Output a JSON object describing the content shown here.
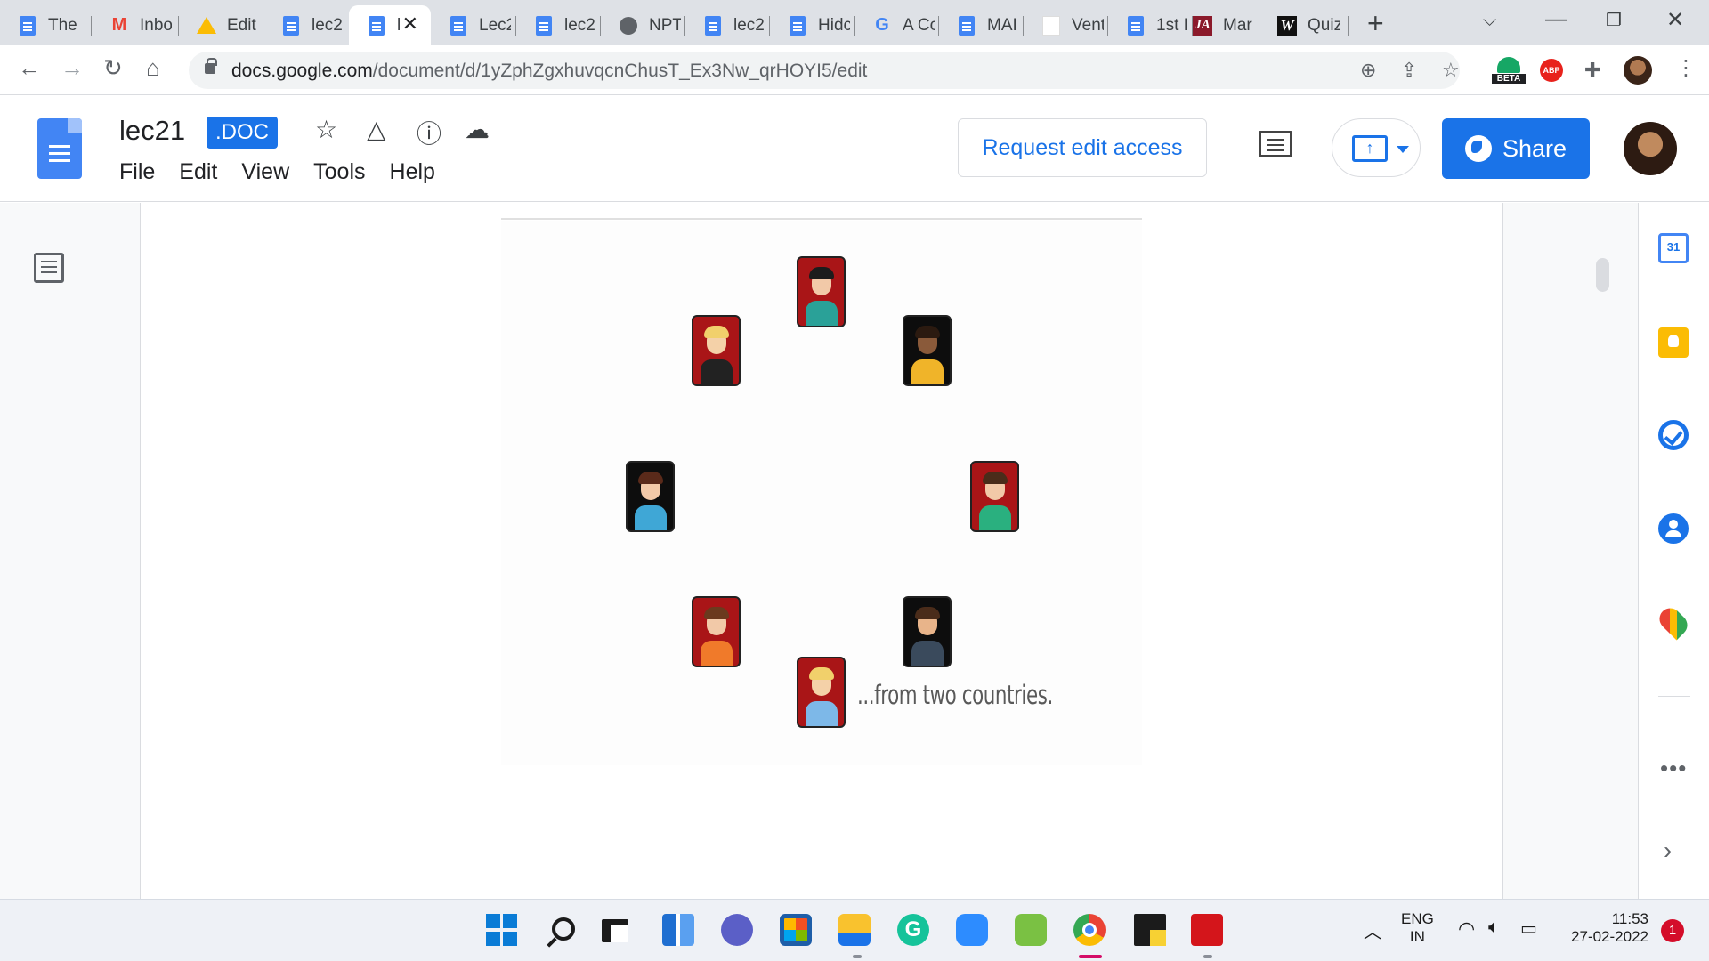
{
  "browser": {
    "tabs": [
      {
        "label": "The",
        "icon": "docs-icon"
      },
      {
        "label": "Inbo",
        "icon": "gmail-icon"
      },
      {
        "label": "Edit",
        "icon": "drive-icon"
      },
      {
        "label": "lec2",
        "icon": "docs-icon"
      },
      {
        "label": "l",
        "icon": "docs-icon",
        "active": true
      },
      {
        "label": "Lec2",
        "icon": "docs-icon"
      },
      {
        "label": "lec2",
        "icon": "docs-icon"
      },
      {
        "label": "NPT",
        "icon": "globe-icon"
      },
      {
        "label": "lec2",
        "icon": "docs-icon"
      },
      {
        "label": "Hidc",
        "icon": "docs-icon"
      },
      {
        "label": "A Cc",
        "icon": "google-icon"
      },
      {
        "label": "MAI",
        "icon": "docs-icon"
      },
      {
        "label": "Vent",
        "icon": "blank-page-icon"
      },
      {
        "label": "1st I",
        "icon": "docs-icon"
      },
      {
        "label": "Mar",
        "icon": "ja-icon"
      },
      {
        "label": "Quiz",
        "icon": "w-icon"
      }
    ],
    "ja_icon_text": "JA",
    "w_icon_text": "W",
    "url_host": "docs.google.com",
    "url_path": "/document/d/1yZphZgxhuvqcnChusT_Ex3Nw_qrHOYI5/edit",
    "beta_label": "BETA",
    "abp_label": "ABP"
  },
  "docs": {
    "title": "lec21",
    "badge": ".DOC",
    "menu": [
      "File",
      "Edit",
      "View",
      "Tools",
      "Help"
    ],
    "request_edit_label": "Request edit access",
    "share_label": "Share",
    "present_arrow": "↑",
    "calendar_day": "31"
  },
  "slide": {
    "caption": "...from two countries.",
    "people": [
      {
        "card": "red",
        "skin": "#f2c9a8",
        "hair": "#1c1c1c",
        "shirt": "#2aa198"
      },
      {
        "card": "red",
        "skin": "#f4d1a8",
        "hair": "#f1d06b",
        "shirt": "#222222"
      },
      {
        "card": "black",
        "skin": "#8a5a3a",
        "hair": "#2b1a10",
        "shirt": "#f0b429"
      },
      {
        "card": "black",
        "skin": "#f2c9a8",
        "hair": "#5a2a1a",
        "shirt": "#3fa7d6"
      },
      {
        "card": "red",
        "skin": "#f2c9a8",
        "hair": "#4a2c1a",
        "shirt": "#2ab07f"
      },
      {
        "card": "red",
        "skin": "#f2c9a8",
        "hair": "#6b3a1e",
        "shirt": "#f07a2a"
      },
      {
        "card": "black",
        "skin": "#e8b48a",
        "hair": "#4a2c1a",
        "shirt": "#3a4a5c"
      },
      {
        "card": "red",
        "skin": "#f4d1a8",
        "hair": "#f1d06b",
        "shirt": "#7db8e8"
      }
    ]
  },
  "taskbar": {
    "apps": [
      "windows-start-icon",
      "search-icon",
      "task-view-icon",
      "widgets-icon",
      "teams-chat-icon",
      "microsoft-store-icon",
      "file-explorer-icon",
      "grammarly-icon",
      "zoom-icon",
      "evernote-icon",
      "chrome-icon",
      "sticky-notes-icon",
      "acrobat-icon"
    ],
    "lang_line1": "ENG",
    "lang_line2": "IN",
    "time": "11:53",
    "date": "27-02-2022",
    "notification_count": "1"
  },
  "colors": {
    "accent": "#1a73e8",
    "card_red": "#a91517",
    "card_black": "#0d0d0d"
  }
}
